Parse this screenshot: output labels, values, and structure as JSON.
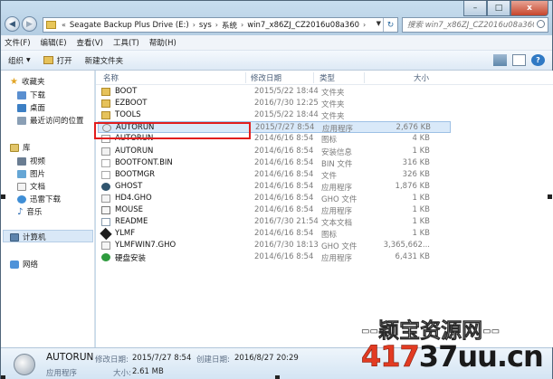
{
  "window": {
    "address": {
      "crumbs": [
        "Seagate Backup Plus Drive (E:)",
        "sys",
        "系统",
        "win7_x86ZJ_CZ2016u08a360"
      ],
      "prefix": "«"
    },
    "search_placeholder": "搜索 win7_x86ZJ_CZ2016u08a360",
    "controls": {
      "minimize": "–",
      "maximize": "□",
      "close": "x"
    }
  },
  "menubar": [
    "文件(F)",
    "编辑(E)",
    "查看(V)",
    "工具(T)",
    "帮助(H)"
  ],
  "toolbar": {
    "organize": "组织",
    "open": "打开",
    "new_folder": "新建文件夹"
  },
  "nav": {
    "favorites": "收藏夹",
    "downloads": "下载",
    "desktop": "桌面",
    "recent": "最近访问的位置",
    "libraries": "库",
    "videos": "视频",
    "pictures": "图片",
    "documents": "文档",
    "xunlei": "迅雷下载",
    "music": "音乐",
    "computer": "计算机",
    "network": "网络"
  },
  "columns": {
    "name": "名称",
    "date": "修改日期",
    "type": "类型",
    "size": "大小"
  },
  "files": [
    {
      "name": "BOOT",
      "date": "2015/5/22 18:44",
      "type": "文件夹",
      "size": "",
      "icon": "folder"
    },
    {
      "name": "EZBOOT",
      "date": "2016/7/30 12:25",
      "type": "文件夹",
      "size": "",
      "icon": "folder"
    },
    {
      "name": "TOOLS",
      "date": "2015/5/22 18:44",
      "type": "文件夹",
      "size": "",
      "icon": "folder"
    },
    {
      "name": "AUTORUN",
      "date": "2015/7/27 8:54",
      "type": "应用程序",
      "size": "2,676 KB",
      "icon": "exe"
    },
    {
      "name": "AUTORUN",
      "date": "2014/6/16 8:54",
      "type": "图标",
      "size": "4 KB",
      "icon": "ico"
    },
    {
      "name": "AUTORUN",
      "date": "2014/6/16 8:54",
      "type": "安装信息",
      "size": "1 KB",
      "icon": "inf"
    },
    {
      "name": "BOOTFONT.BIN",
      "date": "2014/6/16 8:54",
      "type": "BIN 文件",
      "size": "316 KB",
      "icon": "file"
    },
    {
      "name": "BOOTMGR",
      "date": "2014/6/16 8:54",
      "type": "文件",
      "size": "326 KB",
      "icon": "file"
    },
    {
      "name": "GHOST",
      "date": "2014/6/16 8:54",
      "type": "应用程序",
      "size": "1,876 KB",
      "icon": "ghost"
    },
    {
      "name": "HD4.GHO",
      "date": "2014/6/16 8:54",
      "type": "GHO 文件",
      "size": "1 KB",
      "icon": "gho"
    },
    {
      "name": "MOUSE",
      "date": "2014/6/16 8:54",
      "type": "应用程序",
      "size": "1 KB",
      "icon": "mouse"
    },
    {
      "name": "README",
      "date": "2016/7/30 21:54",
      "type": "文本文档",
      "size": "1 KB",
      "icon": "txt"
    },
    {
      "name": "YLMF",
      "date": "2014/6/16 8:54",
      "type": "图标",
      "size": "1 KB",
      "icon": "ylmf"
    },
    {
      "name": "YLMFWIN7.GHO",
      "date": "2016/7/30 18:13",
      "type": "GHO 文件",
      "size": "3,365,662...",
      "icon": "gho"
    },
    {
      "name": "硬盘安装",
      "date": "2014/6/16 8:54",
      "type": "应用程序",
      "size": "6,431 KB",
      "icon": "green"
    }
  ],
  "selected_index": 3,
  "details": {
    "name": "AUTORUN",
    "modified_label": "修改日期:",
    "modified_value": "2015/7/27 8:54",
    "created_label": "创建日期:",
    "created_value": "2016/8/27 20:29",
    "type": "应用程序",
    "size_label": "大小:",
    "size_value": "2.61 MB"
  },
  "watermark": {
    "top": "--颖宝资源网--",
    "bottom_num": "417",
    "bottom_text": "37uu.cn"
  }
}
